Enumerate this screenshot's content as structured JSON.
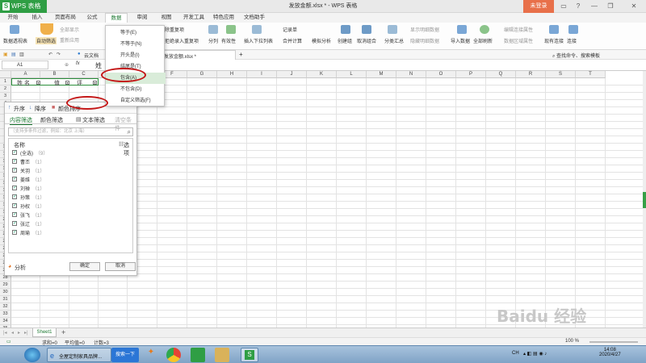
{
  "app": {
    "name": "WPS 表格",
    "logo_letter": "S",
    "doc_title": "发放金额.xlsx * - WPS 表格",
    "login": "未登录"
  },
  "window_controls": [
    "▭",
    "?",
    "—",
    "❐",
    "✕"
  ],
  "menu": {
    "tabs": [
      "开始",
      "插入",
      "页面布局",
      "公式",
      "数据",
      "审阅",
      "视图",
      "开发工具",
      "特色应用",
      "文档助手"
    ],
    "active": "数据"
  },
  "ribbon": {
    "pivot": "数据透视表",
    "autofilter": "自动筛选",
    "show_all": "全部显示",
    "reapply": "重新应用",
    "highlight_dup": "除重复项",
    "reject_dup": "拒绝录入重复项",
    "split": "分列",
    "validity": "有效性",
    "dropdown_list": "插入下拉列表",
    "record": "记录单",
    "merge_calc": "合并计算",
    "simulate": "模拟分析",
    "create_group": "创建组",
    "ungroup": "取消组合",
    "subtotal": "分类汇总",
    "show_detail": "显示明细数据",
    "hide_detail": "隐藏明细数据",
    "import": "导入数据",
    "refresh_all": "全部刷新",
    "edit_link": "编辑连接属性",
    "data_area": "数据区域属性",
    "existing_conn": "现有连接",
    "connect": "连接",
    "search": "查找命令、搜索模板"
  },
  "qat": {
    "cloud_doc": "云文档",
    "tab_name": "发放金额.xlsx *",
    "add_tab": "+"
  },
  "formula": {
    "cell_ref": "A1",
    "fx": "fx",
    "value": "姓"
  },
  "grid": {
    "columns": [
      "A",
      "B",
      "C",
      "D",
      "E",
      "F",
      "G",
      "H",
      "I",
      "J",
      "K",
      "L",
      "M",
      "N",
      "O",
      "P",
      "Q",
      "R",
      "S",
      "T"
    ],
    "header_cells": [
      "姓 名",
      "值",
      "评",
      "价"
    ],
    "visible_rows": [
      "1",
      "2",
      "3",
      "4",
      "5",
      "6",
      "7",
      "8",
      "9",
      "10",
      "11",
      "12",
      "13",
      "14",
      "15",
      "16",
      "17",
      "18",
      "19",
      "20",
      "21",
      "22",
      "23",
      "24",
      "25",
      "26",
      "27",
      "28",
      "29",
      "30",
      "31",
      "32",
      "33",
      "34",
      "35"
    ]
  },
  "filter_panel": {
    "sort_asc": "升序",
    "sort_desc": "降序",
    "color_sort": "颜色排序",
    "tab_content": "内容筛选",
    "tab_color": "颜色筛选",
    "tab_text": "文本筛选",
    "tab_clear": "清空条件",
    "search_placeholder": "（支持多条件过滤，例如：北京 上海）",
    "list_header": "名称",
    "options": "选项",
    "items": [
      {
        "label": "(全选)",
        "count": "（9）"
      },
      {
        "label": "曹丕",
        "count": "（1）"
      },
      {
        "label": "关羽",
        "count": "（1）"
      },
      {
        "label": "姜维",
        "count": "（1）"
      },
      {
        "label": "刘禅",
        "count": "（1）"
      },
      {
        "label": "孙策",
        "count": "（1）"
      },
      {
        "label": "孙权",
        "count": "（1）"
      },
      {
        "label": "张飞",
        "count": "（1）"
      },
      {
        "label": "张辽",
        "count": "（1）"
      },
      {
        "label": "周瑜",
        "count": "（1）"
      }
    ],
    "analyze": "分析",
    "ok": "确定",
    "cancel": "取消"
  },
  "text_filter_menu": [
    "等于(E)",
    "不等于(N)",
    "开头是(I)",
    "结尾是(T)",
    "包含(A)",
    "不包含(D)",
    "自定义筛选(F)"
  ],
  "text_filter_highlighted": "包含(A)",
  "sheetbar": {
    "sheet": "Sheet1",
    "add": "+"
  },
  "status": {
    "sum": "求和=0",
    "avg": "平均值=0",
    "count": "计数=3",
    "zoom": "100 %"
  },
  "taskbar": {
    "ie_title": "全屋定制家具品牌...",
    "search_btn": "搜索一下",
    "time": "14:08",
    "date": "2020/4/27",
    "lang": "CH"
  },
  "watermark": "Baidu 经验",
  "colors": {
    "brand": "#2f9e44",
    "login": "#e8704a",
    "highlight": "#c41818",
    "active_tab": "#1f7a34"
  }
}
